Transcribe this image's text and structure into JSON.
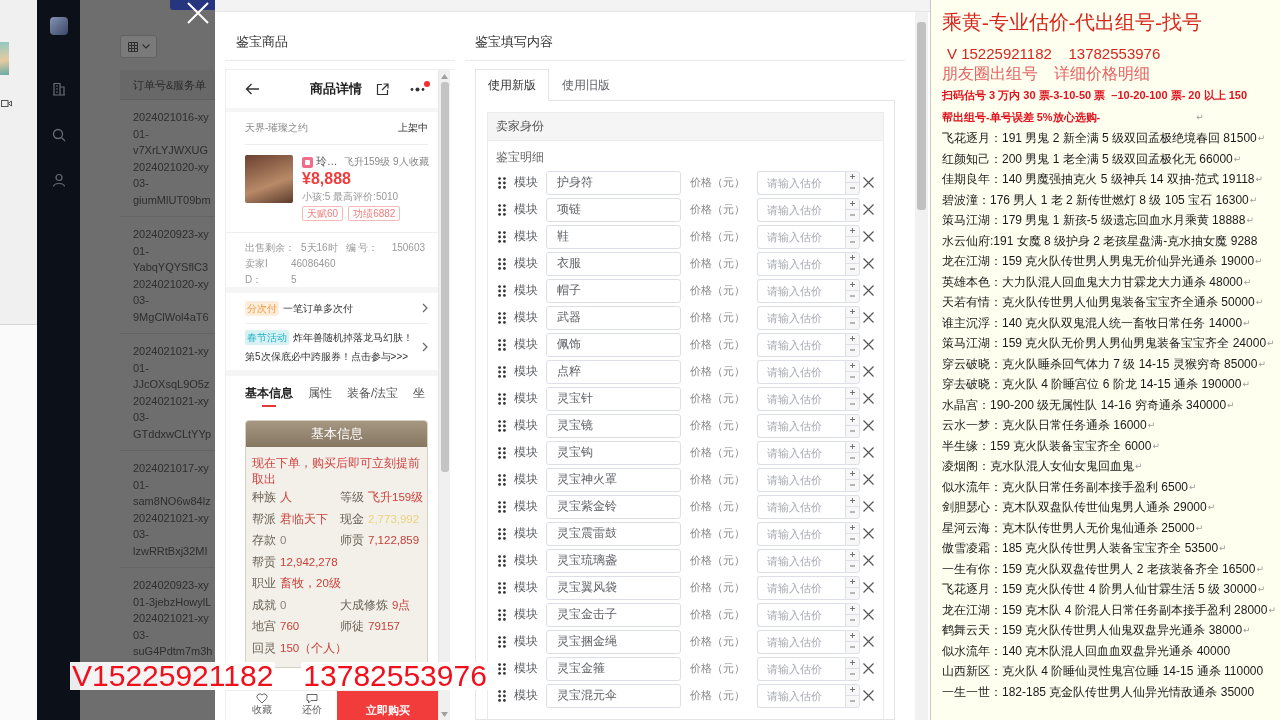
{
  "backdrop": {
    "table": {
      "header": "订单号&服务单",
      "rows": [
        {
          "lines": [
            "2024021016-xy",
            "01-",
            "v7XrLYJWXUG",
            "2024021020-xy",
            "03-",
            "giumMlUT09bm"
          ]
        },
        {
          "lines": [
            "2024020923-xy",
            "01-",
            "YabqYQYSflC3",
            "2024021020-xy",
            "03-",
            "9MgClWol4aT6"
          ]
        },
        {
          "lines": [
            "2024021021-xy",
            "01-",
            "JJcOXsqL9O5z",
            "2024021021-xy",
            "03-",
            "GTddxwCLtYYp"
          ]
        },
        {
          "lines": [
            "2024021017-xy",
            "01-",
            "sam8NO6w84lz",
            "2024021021-xy",
            "03-",
            "lzwRRtBxj32MI"
          ]
        },
        {
          "lines": [
            "2024020923-xy",
            "01-3jebzHowylL",
            "2024021021-xy",
            "03-",
            "suG4Pdtm7m3h"
          ]
        }
      ]
    }
  },
  "modal": {
    "preview_title": "鉴宝商品",
    "form_title": "鉴宝填写内容",
    "preview": {
      "nav": {
        "title": "商品详情",
        "menu_badge": true
      },
      "server": "天界-璀璨之约",
      "status": "上架中",
      "item": {
        "name": "玲…",
        "meta": "飞升159级 9人收藏",
        "price": "¥8,888",
        "stats": "小孩:5 最高评价:5010",
        "tags": [
          "天赋60",
          "功绩6882"
        ]
      },
      "sale_info": [
        [
          {
            "label": "出售剩余：",
            "value": "5天16时"
          },
          {
            "label": "编 号：",
            "value": "150603"
          }
        ],
        [
          {
            "label": "卖家I",
            "value": "46086460"
          }
        ],
        [
          {
            "label": "D：",
            "value": "5"
          }
        ]
      ],
      "promos": [
        {
          "kind": "installment",
          "badge": "分次付",
          "lines": [
            "一笔订单多次付"
          ]
        },
        {
          "kind": "event",
          "badge": "春节活动",
          "lines": [
            "炸年兽随机掉落龙马幻肤！",
            "第5次保底必中跨服券！点击参与>>>"
          ]
        }
      ],
      "tabs": [
        {
          "label": "基本信息",
          "selected": true
        },
        {
          "label": "属性",
          "selected": false
        },
        {
          "label": "装备/法宝",
          "selected": false
        },
        {
          "label": "坐",
          "selected": false
        }
      ],
      "info_card": {
        "title": "基本信息",
        "notice": "现在下单，购买后即可立刻提前取出",
        "rows": [
          [
            {
              "label": "种族",
              "value": "人",
              "kind": "highlight"
            },
            {
              "label": "等级",
              "value": "飞升159级",
              "kind": "highlight"
            }
          ],
          [
            {
              "label": "帮派",
              "value": "君临天下",
              "kind": "highlight"
            },
            {
              "label": "现金",
              "value": "2,773,992",
              "kind": "faint"
            }
          ],
          [
            {
              "label": "存款",
              "value": "0",
              "kind": "plain"
            },
            {
              "label": "师贡",
              "value": "7,122,859",
              "kind": "highlight"
            }
          ],
          [
            {
              "label": "帮贡",
              "value": "12,942,278",
              "kind": "highlight"
            }
          ],
          [
            {
              "label": "职业",
              "value": "畜牧，20级",
              "kind": "highlight"
            }
          ],
          [
            {
              "label": "成就",
              "value": "0",
              "kind": "plain"
            },
            {
              "label": "大成修炼",
              "value": "9点",
              "kind": "highlight"
            }
          ],
          [
            {
              "label": "地宫",
              "value": "760",
              "kind": "highlight"
            },
            {
              "label": "师徒",
              "value": "79157",
              "kind": "highlight"
            }
          ],
          [
            {
              "label": "回灵",
              "value": "150（个人）",
              "kind": "highlight"
            }
          ]
        ]
      },
      "actions": [
        {
          "kind": "favorite",
          "label": "收藏"
        },
        {
          "kind": "bargain",
          "label": "还价"
        },
        {
          "kind": "buy",
          "label": "立即购买"
        }
      ]
    },
    "form": {
      "tabs": [
        {
          "label": "使用新版",
          "selected": true
        },
        {
          "label": "使用旧版",
          "selected": false
        }
      ],
      "section_title": "卖家身份",
      "detail_label": "鉴宝明细",
      "rows": [
        {
          "label": "模块",
          "value": "护身符",
          "price_label": "价格（元）",
          "placeholder": "请输入估价"
        },
        {
          "label": "模块",
          "value": "项链",
          "price_label": "价格（元）",
          "placeholder": "请输入估价"
        },
        {
          "label": "模块",
          "value": "鞋",
          "price_label": "价格（元）",
          "placeholder": "请输入估价"
        },
        {
          "label": "模块",
          "value": "衣服",
          "price_label": "价格（元）",
          "placeholder": "请输入估价"
        },
        {
          "label": "模块",
          "value": "帽子",
          "price_label": "价格（元）",
          "placeholder": "请输入估价"
        },
        {
          "label": "模块",
          "value": "武器",
          "price_label": "价格（元）",
          "placeholder": "请输入估价"
        },
        {
          "label": "模块",
          "value": "佩饰",
          "price_label": "价格（元）",
          "placeholder": "请输入估价"
        },
        {
          "label": "模块",
          "value": "点粹",
          "price_label": "价格（元）",
          "placeholder": "请输入估价"
        },
        {
          "label": "模块",
          "value": "灵宝针",
          "price_label": "价格（元）",
          "placeholder": "请输入估价"
        },
        {
          "label": "模块",
          "value": "灵宝镜",
          "price_label": "价格（元）",
          "placeholder": "请输入估价"
        },
        {
          "label": "模块",
          "value": "灵宝钩",
          "price_label": "价格（元）",
          "placeholder": "请输入估价"
        },
        {
          "label": "模块",
          "value": "灵宝神火罩",
          "price_label": "价格（元）",
          "placeholder": "请输入估价"
        },
        {
          "label": "模块",
          "value": "灵宝紫金铃",
          "price_label": "价格（元）",
          "placeholder": "请输入估价"
        },
        {
          "label": "模块",
          "value": "灵宝震雷鼓",
          "price_label": "价格（元）",
          "placeholder": "请输入估价"
        },
        {
          "label": "模块",
          "value": "灵宝琉璃盏",
          "price_label": "价格（元）",
          "placeholder": "请输入估价"
        },
        {
          "label": "模块",
          "value": "灵宝翼风袋",
          "price_label": "价格（元）",
          "placeholder": "请输入估价"
        },
        {
          "label": "模块",
          "value": "灵宝金击子",
          "price_label": "价格（元）",
          "placeholder": "请输入估价"
        },
        {
          "label": "模块",
          "value": "灵宝捆金绳",
          "price_label": "价格（元）",
          "placeholder": "请输入估价"
        },
        {
          "label": "模块",
          "value": "灵宝金箍",
          "price_label": "价格（元）",
          "placeholder": "请输入估价"
        },
        {
          "label": "模块",
          "value": "灵宝混元伞",
          "price_label": "价格（元）",
          "placeholder": "请输入估价"
        }
      ]
    }
  },
  "overlay_text": [
    "V15225921182",
    "13782553976"
  ],
  "price_sheet": {
    "title": "乘黄-专业估价-代出组号-找号",
    "contact": "V 15225921182    13782553976",
    "subtitle": "朋友圈出组号    详细价格明细",
    "notes": [
      {
        "text": "扫码估号 3 万内 30 票-3-10-50 票  –10-20-100 票- 20 以上 150"
      },
      {
        "text": "帮出组号-单号误差 5%放心选购-",
        "end_mark": "↵"
      }
    ],
    "listings": [
      {
        "text": "飞花逐月：191 男鬼 2 新全满 5 级双回孟极绝境春回 81500",
        "end_mark": "↵"
      },
      {
        "text": "红颜知己：200 男鬼 1 老全满 5 级双回孟极化无 66000",
        "end_mark": "↵"
      },
      {
        "text": "佳期良年：140 男魔强抽克火 5 级神兵 14 双抽-范式 19118",
        "end_mark": "↵"
      },
      {
        "text": "碧波潼：176 男人 1 老 2 新传世燃灯 8 级 105 宝石 16300",
        "end_mark": "↵"
      },
      {
        "text": "策马江湖：179 男鬼 1 新孩-5 级遗忘回血水月乘黄 18888",
        "end_mark": "↵"
      },
      {
        "text": "水云仙府:191 女魔 8 级护身 2 老孩星盘满-克水抽女魔 9288"
      },
      {
        "text": "龙在江湖：159 克火队传世男人男鬼无价仙异光通杀 19000",
        "end_mark": "↵"
      },
      {
        "text": "英雄本色：大力队混人回血鬼大力甘霖龙大力通杀 48000",
        "end_mark": "↵"
      },
      {
        "text": "天若有情：克火队传世男人仙男鬼装备宝宝齐全通杀 50000",
        "end_mark": "↵"
      },
      {
        "text": "谁主沉浮：140 克火队双鬼混人统一畜牧日常任务 14000",
        "end_mark": "↵"
      },
      {
        "text": "策马江湖：159 克火队无价男人男仙男鬼装备宝宝齐全 24000",
        "end_mark": "↵"
      },
      {
        "text": "穿云破晓：克火队睡杀回气体力 7 级 14-15 灵猴穷奇 85000",
        "end_mark": "↵"
      },
      {
        "text": "穿去破晓：克火队 4 阶睡宫位 6 阶龙 14-15 通杀 190000",
        "end_mark": "↵"
      },
      {
        "text": "水晶宫：190-200 级无属性队 14-16 穷奇通杀 340000",
        "end_mark": "↵"
      },
      {
        "text": "云水一梦：克火队日常任务通杀 16000",
        "end_mark": "↵"
      },
      {
        "text": "半生缘：159 克火队装备宝宝齐全 6000",
        "end_mark": "↵"
      },
      {
        "text": "凌烟阁：克水队混人女仙女鬼回血鬼",
        "end_mark": "↵"
      },
      {
        "text": "似水流年：克火队日常任务副本接手盈利 6500",
        "end_mark": "↵"
      },
      {
        "text": "剑胆瑟心：克木队双盘队传世仙鬼男人通杀 29000",
        "end_mark": "↵"
      },
      {
        "text": "星河云海：克木队传世男人无价鬼仙通杀 25000",
        "end_mark": "↵"
      },
      {
        "text": "傲雪凌霜：185 克火队传世男人装备宝宝齐全 53500",
        "end_mark": "↵"
      },
      {
        "text": "一生有你：159 克火队双盘传世男人 2 老孩装备齐全 16500",
        "end_mark": "↵"
      },
      {
        "text": "飞花逐月：159 克火队传世 4 阶男人仙甘霖生活 5 级 30000",
        "end_mark": "↵"
      },
      {
        "text": "龙在江湖：159 克木队 4 阶混人日常任务副本接手盈利 28000",
        "end_mark": "↵"
      },
      {
        "text": "鹤舞云天：159 克火队传世男人仙鬼双盘异光通杀 38000",
        "end_mark": "↵"
      },
      {
        "text": "似水流年：140 克木队混人回血血双盘异光通杀 40000"
      },
      {
        "text": "山西新区：克火队 4 阶睡仙灵性鬼宫位睡 14-15 通杀 110000"
      },
      {
        "text": "一生一世：182-185 克金队传世男人仙异光情敌通杀 35000"
      }
    ]
  }
}
